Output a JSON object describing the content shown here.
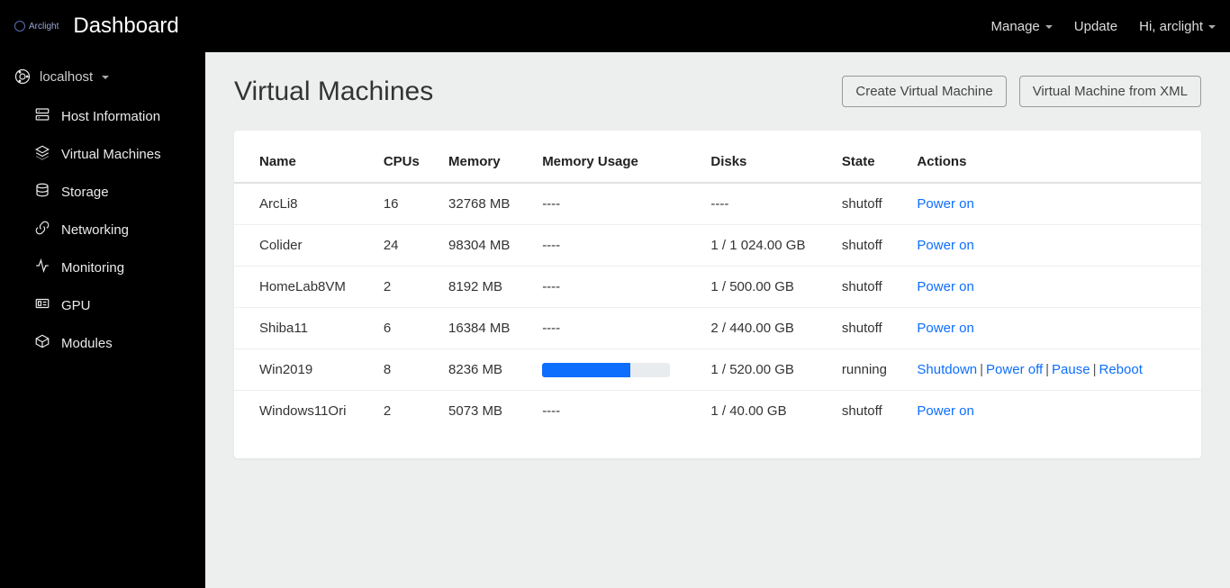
{
  "header": {
    "brand": "Arclight",
    "title": "Dashboard",
    "nav": {
      "manage": "Manage",
      "update": "Update",
      "user": "Hi, arclight"
    }
  },
  "sidebar": {
    "host": "localhost",
    "items": [
      {
        "label": "Host Information"
      },
      {
        "label": "Virtual Machines"
      },
      {
        "label": "Storage"
      },
      {
        "label": "Networking"
      },
      {
        "label": "Monitoring"
      },
      {
        "label": "GPU"
      },
      {
        "label": "Modules"
      }
    ]
  },
  "main": {
    "title": "Virtual Machines",
    "buttons": {
      "create": "Create Virtual Machine",
      "from_xml": "Virtual Machine from XML"
    },
    "columns": [
      "Name",
      "CPUs",
      "Memory",
      "Memory Usage",
      "Disks",
      "State",
      "Actions"
    ],
    "rows": [
      {
        "name": "ArcLi8",
        "cpus": "16",
        "memory": "32768 MB",
        "usage": null,
        "disks": "----",
        "state": "shutoff",
        "actions": [
          "Power on"
        ]
      },
      {
        "name": "Colider",
        "cpus": "24",
        "memory": "98304 MB",
        "usage": null,
        "disks": "1 / 1 024.00 GB",
        "state": "shutoff",
        "actions": [
          "Power on"
        ]
      },
      {
        "name": "HomeLab8VM",
        "cpus": "2",
        "memory": "8192 MB",
        "usage": null,
        "disks": "1 / 500.00 GB",
        "state": "shutoff",
        "actions": [
          "Power on"
        ]
      },
      {
        "name": "Shiba11",
        "cpus": "6",
        "memory": "16384 MB",
        "usage": null,
        "disks": "2 / 440.00 GB",
        "state": "shutoff",
        "actions": [
          "Power on"
        ]
      },
      {
        "name": "Win2019",
        "cpus": "8",
        "memory": "8236 MB",
        "usage": 69,
        "disks": "1 / 520.00 GB",
        "state": "running",
        "actions": [
          "Shutdown",
          "Power off",
          "Pause",
          "Reboot"
        ]
      },
      {
        "name": "Windows11Ori",
        "cpus": "2",
        "memory": "5073 MB",
        "usage": null,
        "disks": "1 / 40.00 GB",
        "state": "shutoff",
        "actions": [
          "Power on"
        ]
      }
    ],
    "empty_placeholder": "----"
  }
}
